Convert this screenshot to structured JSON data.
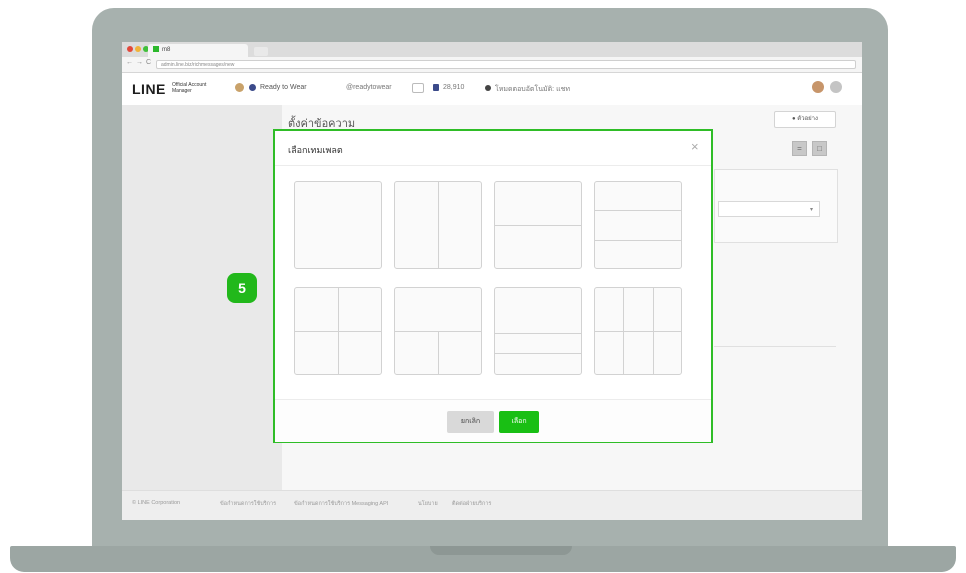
{
  "browser": {
    "tab_title": "m8",
    "url": "admin.line.biz/richmessages/new",
    "back_glyph": "←",
    "forward_glyph": "→",
    "reload_glyph": "C",
    "window_controls_colors": [
      "#e2483b",
      "#f0b33a",
      "#3fbf3a"
    ]
  },
  "header": {
    "logo": "LINE",
    "logo_sub": "Official Account Manager",
    "account_name": "Ready to Wear",
    "account_id": "@readytowear",
    "friends_count": "28,910",
    "chat_mode": "โหมดตอบอัตโนมัติ: แชท"
  },
  "page": {
    "title": "ตั้งค่าข้อความ",
    "preview_label": "ตัวอย่าง",
    "view_toggle_1": "=",
    "view_toggle_2": "□",
    "select_arrow": "▾"
  },
  "step": {
    "number": "5"
  },
  "modal": {
    "title": "เลือกเทมเพลต",
    "close": "×",
    "templates": [
      {
        "name": "template-1-full"
      },
      {
        "name": "template-2-columns"
      },
      {
        "name": "template-2-rows"
      },
      {
        "name": "template-3-rows"
      },
      {
        "name": "template-4-grid"
      },
      {
        "name": "template-top-bottom-split"
      },
      {
        "name": "template-top-2-strips"
      },
      {
        "name": "template-3-columns-2-rows"
      }
    ],
    "cancel_label": "ยกเลิก",
    "select_label": "เลือก"
  },
  "footer": {
    "copyright": "© LINE Corporation",
    "links": [
      "ข้อกำหนดการใช้บริการ",
      "ข้อกำหนดการใช้บริการ Messaging API",
      "นโยบาย",
      "ติดต่อฝ่ายบริการ"
    ]
  },
  "colors": {
    "accent": "#2fbd27",
    "select_button": "#19bf14",
    "laptop": "#a7b1ae"
  }
}
